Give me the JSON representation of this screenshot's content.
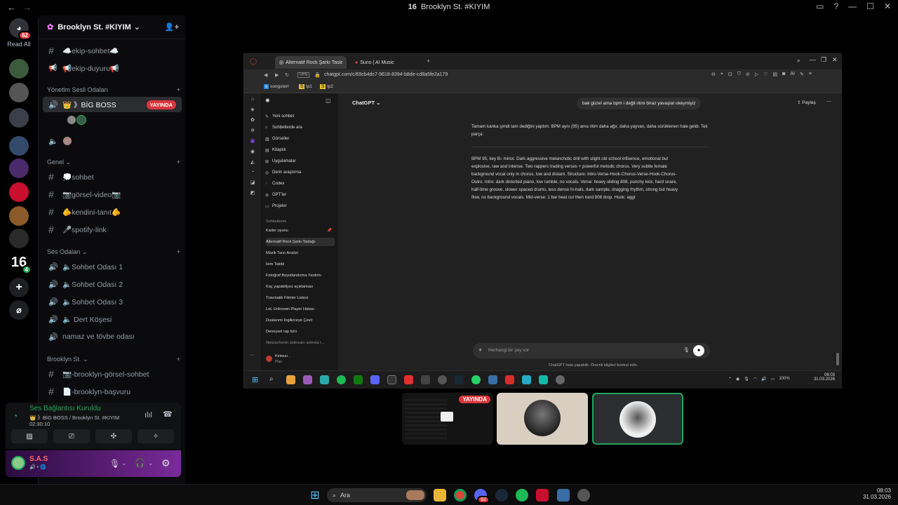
{
  "window": {
    "title": "Brooklyn St. #KIYIM",
    "title_badge": "16"
  },
  "rail": {
    "home_badge": "62",
    "read_all": "Read All",
    "servers": [
      {
        "name": "server-1"
      },
      {
        "name": "server-2"
      },
      {
        "name": "server-3"
      },
      {
        "name": "server-4"
      },
      {
        "name": "server-5"
      },
      {
        "name": "server-6"
      },
      {
        "name": "server-7"
      },
      {
        "name": "server-8"
      },
      {
        "name": "server-brooklyn",
        "label": "16",
        "badge": "4"
      }
    ],
    "add_server": "+",
    "discover": "⌀"
  },
  "sidebar": {
    "server_name": "Brooklyn St. #KIYIM",
    "channels_top": [
      {
        "label": "☁️ekip-sohbet☁️",
        "icon": "#"
      },
      {
        "label": "📢ekip-duyuru📢",
        "icon": "📢"
      }
    ],
    "cat_admin_voice": "Yönetim Sesli Odaları",
    "active_voice": "👑 》BİG BOSS",
    "live_label": "YAYINDA",
    "cat_general": "Genel",
    "general_channels": [
      {
        "label": "💭sohbet"
      },
      {
        "label": "📷görsel-video📷"
      },
      {
        "label": "🫵kendini-tanıt🫵"
      },
      {
        "label": "🎤spotify-link"
      }
    ],
    "cat_voice": "Ses Odaları",
    "voice_channels": [
      {
        "label": "🔈Sohbet Odası 1"
      },
      {
        "label": "🔈Sohbet Odası 2"
      },
      {
        "label": "🔈Sohbet Odası 3"
      },
      {
        "label": "🔈 Dert Köşesi"
      },
      {
        "label": "namaz ve tövbe odası"
      }
    ],
    "cat_brooklyn": "Brooklyn St.",
    "brooklyn_channels": [
      {
        "label": "📷-brooklyn-görsel-sohbet"
      },
      {
        "label": "📄-brooklyn-başvuru"
      }
    ]
  },
  "voice_panel": {
    "status": "Ses Bağlantısı Kuruldu",
    "location": "👑 》BİG BOSS / Brooklyn St. #KIYIM",
    "timer": "02:30:10"
  },
  "user_panel": {
    "username": "S.A.S",
    "sub": "🔊 • 🌐"
  },
  "browser": {
    "tabs": [
      {
        "label": "Alternatif Rock Şarkı Taslağı"
      },
      {
        "label": "Suno | AI Music"
      }
    ],
    "url": "chatgpt.com/c/69cb4dc7-9618-8394-b8de-cd8a5fe2a179",
    "vpn": "VPN",
    "bookmarks": [
      "songsterr",
      "lp1",
      "lp2"
    ],
    "ai_label": "AI"
  },
  "chatgpt": {
    "model_label": "ChatGPT ⌄",
    "share_label": "Paylaş",
    "sidebar_items": [
      "Yeni sohbet",
      "Sohbetlerde ara",
      "Görseller",
      "Kitaplık",
      "Uygulamalar",
      "Derin araştırma",
      "Codex",
      "GPT'ler",
      "Projeler"
    ],
    "section_chats": "Sohbetlerim",
    "history": [
      "Kader oyunu",
      "Alternatif Rock Şarkı Taslağı",
      "Müzik Tarzı Analizi",
      "İsim Talebi",
      "Fotoğraf Boyutlandırma Yardımı",
      "Kaç yapabiliyoz açıklaması",
      "Travmatik Filmler Listesi",
      "LoL Unknown Player Hatası",
      "Dualarımı İngilizceye Çevir",
      "Deneysel rap türü",
      "Nietzschenin üstinsanı aslında t..."
    ],
    "user_name": "Kiriwuu .",
    "user_plan": "Plus",
    "user_msg": "bak güzel ama bpm i değil ritmi biraz yavaşlat okeymiyiz",
    "reply_intro": "Tamam kanka şimdi tam dediğini yaptım: BPM aynı (95) ama ritim daha ağır, daha yayvan, daha sürüklenen hale geldi. Tek parça:",
    "reply_lines": [
      "BPM 95, key B♭ minor. Dark aggressive melancholic drill with slight old school influence, emotional but",
      "explosive, raw and intense. Two rappers trading verses + powerful melodic chorus. Very subtle female",
      "background vocal only in chorus, low and distant. Structure: Intro-Verse-Hook-Chorus-Verse-Hook-Chorus-",
      "Outro. Intro: dark distorted piano, low rumble, no vocals. Verse: heavy sliding 808, punchy kick, hard snare,",
      "half-time groove, slower spaced drums, less dense hi-hats, dark sample, dragging rhythm, strong but heavy",
      "flow, no background vocals. Mid-verse: 1 bar beat cut then hard 808 drop. Hook: aggr"
    ],
    "composer_placeholder": "Herhangi bir şey sor",
    "disclaimer": "ChatGPT hata yapabilir. Önemli bilgileri kontrol edin."
  },
  "inner_taskbar": {
    "battery": "100%",
    "time": "08:03",
    "date": "31.03.2026"
  },
  "tiles": {
    "live_label": "YAYINDA"
  },
  "taskbar": {
    "search": "Ara",
    "time": "08:03",
    "date": "31.03.2026",
    "discord_badge": "62"
  },
  "colors": {
    "live": "#da373c",
    "speaking": "#23a55a",
    "accent": "#5865f2"
  }
}
